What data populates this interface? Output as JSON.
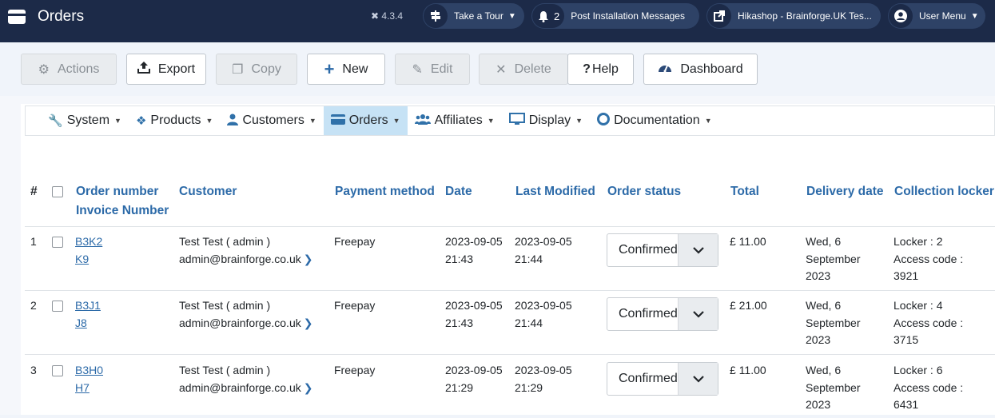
{
  "header": {
    "title": "Orders",
    "version": "4.3.4",
    "tour_label": "Take a Tour",
    "messages_count": "2",
    "messages_label": "Post Installation Messages",
    "site_label": "Hikashop - Brainforge.UK Tes...",
    "user_label": "User Menu"
  },
  "toolbar": {
    "actions": "Actions",
    "export": "Export",
    "copy": "Copy",
    "new": "New",
    "edit": "Edit",
    "delete": "Delete",
    "help": "Help",
    "dashboard": "Dashboard"
  },
  "menu": {
    "system": "System",
    "products": "Products",
    "customers": "Customers",
    "orders": "Orders",
    "affiliates": "Affiliates",
    "display": "Display",
    "documentation": "Documentation"
  },
  "table": {
    "headers": {
      "num": "#",
      "order_number": "Order number",
      "invoice_number": "Invoice Number",
      "customer": "Customer",
      "payment": "Payment method",
      "date": "Date",
      "modified": "Last Modified",
      "status": "Order status",
      "total": "Total",
      "delivery": "Delivery date",
      "locker": "Collection locker"
    },
    "rows": [
      {
        "num": "1",
        "order": "B3K2",
        "invoice": "K9",
        "customer": "Test Test ( admin )",
        "email": "admin@brainforge.co.uk",
        "payment": "Freepay",
        "date1": "2023-09-05",
        "date2": "21:43",
        "mod1": "2023-09-05",
        "mod2": "21:44",
        "status": "Confirmed",
        "total": "£ 11.00",
        "del1": "Wed, 6",
        "del2": "September",
        "del3": "2023",
        "lock1": "Locker : 2",
        "lock2": "Access code :",
        "lock3": "3921"
      },
      {
        "num": "2",
        "order": "B3J1",
        "invoice": "J8",
        "customer": "Test Test ( admin )",
        "email": "admin@brainforge.co.uk",
        "payment": "Freepay",
        "date1": "2023-09-05",
        "date2": "21:43",
        "mod1": "2023-09-05",
        "mod2": "21:44",
        "status": "Confirmed",
        "total": "£ 21.00",
        "del1": "Wed, 6",
        "del2": "September",
        "del3": "2023",
        "lock1": "Locker : 4",
        "lock2": "Access code :",
        "lock3": "3715"
      },
      {
        "num": "3",
        "order": "B3H0",
        "invoice": "H7",
        "customer": "Test Test ( admin )",
        "email": "admin@brainforge.co.uk",
        "payment": "Freepay",
        "date1": "2023-09-05",
        "date2": "21:29",
        "mod1": "2023-09-05",
        "mod2": "21:29",
        "status": "Confirmed",
        "total": "£ 11.00",
        "del1": "Wed, 6",
        "del2": "September",
        "del3": "2023",
        "lock1": "Locker : 6",
        "lock2": "Access code :",
        "lock3": "6431"
      }
    ]
  }
}
